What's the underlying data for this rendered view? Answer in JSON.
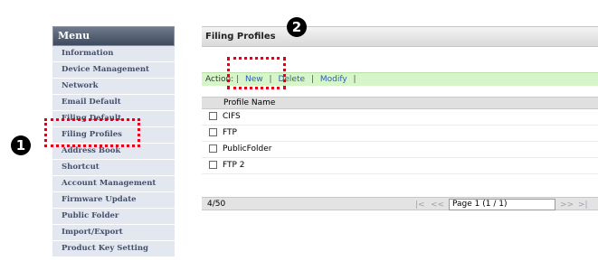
{
  "sidebar": {
    "header": "Menu",
    "items": [
      "Information",
      "Device Management",
      "Network",
      "Email Default",
      "Filing Default",
      "Filing Profiles",
      "Address Book",
      "Shortcut",
      "Account Management",
      "Firmware Update",
      "Public Folder",
      "Import/Export",
      "Product Key Setting"
    ]
  },
  "main": {
    "title": "Filing Profiles",
    "action_label": "Action:",
    "actions": {
      "new": "New",
      "delete": "Delete",
      "modify": "Modify"
    },
    "separator": "|",
    "column_header": "Profile Name",
    "rows": [
      "CIFS",
      "FTP",
      "PublicFolder",
      "FTP 2"
    ],
    "count": "4/50",
    "pager": {
      "first": "|<",
      "prev": "<<",
      "page": "Page 1 (1 / 1)",
      "next": ">>",
      "last": ">|"
    }
  },
  "callouts": {
    "marker_1": "1",
    "marker_2": "2"
  },
  "colors": {
    "callout_border": "#e0001a",
    "action_bar": "#d6f5c8",
    "menu_header": "#3f4a5e",
    "link": "#2c5db8"
  }
}
